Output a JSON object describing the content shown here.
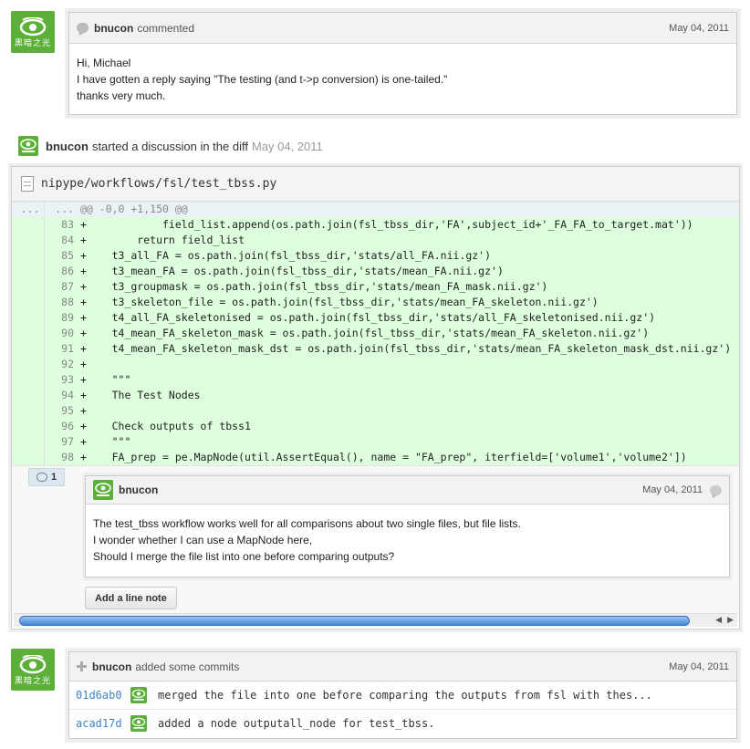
{
  "brand_color": "#5cb039",
  "avatar_text": "黑暗之光",
  "comment1": {
    "author": "bnucon",
    "action": "commented",
    "date": "May 04, 2011",
    "lines": [
      "Hi, Michael",
      "I have gotten a reply saying \"The testing (and t->p conversion) is one-tailed.\"",
      "thanks very much."
    ]
  },
  "discussion": {
    "author": "bnucon",
    "action": "started a discussion in the diff",
    "date": "May 04, 2011"
  },
  "diff": {
    "file_path": "nipype/workflows/fsl/test_tbss.py",
    "hunk": {
      "old_ln": "...",
      "new_ln": "...",
      "text": "@@ -0,0 +1,150 @@"
    },
    "lines": [
      {
        "ln": "83",
        "text": "+            field_list.append(os.path.join(fsl_tbss_dir,'FA',subject_id+'_FA_FA_to_target.mat'))"
      },
      {
        "ln": "84",
        "text": "+        return field_list"
      },
      {
        "ln": "85",
        "text": "+    t3_all_FA = os.path.join(fsl_tbss_dir,'stats/all_FA.nii.gz')"
      },
      {
        "ln": "86",
        "text": "+    t3_mean_FA = os.path.join(fsl_tbss_dir,'stats/mean_FA.nii.gz')"
      },
      {
        "ln": "87",
        "text": "+    t3_groupmask = os.path.join(fsl_tbss_dir,'stats/mean_FA_mask.nii.gz')"
      },
      {
        "ln": "88",
        "text": "+    t3_skeleton_file = os.path.join(fsl_tbss_dir,'stats/mean_FA_skeleton.nii.gz')"
      },
      {
        "ln": "89",
        "text": "+    t4_all_FA_skeletonised = os.path.join(fsl_tbss_dir,'stats/all_FA_skeletonised.nii.gz')"
      },
      {
        "ln": "90",
        "text": "+    t4_mean_FA_skeleton_mask = os.path.join(fsl_tbss_dir,'stats/mean_FA_skeleton.nii.gz')"
      },
      {
        "ln": "91",
        "text": "+    t4_mean_FA_skeleton_mask_dst = os.path.join(fsl_tbss_dir,'stats/mean_FA_skeleton_mask_dst.nii.gz')"
      },
      {
        "ln": "92",
        "text": "+"
      },
      {
        "ln": "93",
        "text": "+    \"\"\""
      },
      {
        "ln": "94",
        "text": "+    The Test Nodes"
      },
      {
        "ln": "95",
        "text": "+"
      },
      {
        "ln": "96",
        "text": "+    Check outputs of tbss1"
      },
      {
        "ln": "97",
        "text": "+    \"\"\""
      },
      {
        "ln": "98",
        "text": "+    FA_prep = pe.MapNode(util.AssertEqual(), name = \"FA_prep\", iterfield=['volume1','volume2'])"
      }
    ],
    "note_count": "1",
    "inline_comment": {
      "author": "bnucon",
      "date": "May 04, 2011",
      "lines": [
        "The test_tbss workflow works well for all comparisons about two single files, but file lists.",
        "I wonder whether I can use a MapNode here,",
        "Should I merge the file list into one before comparing outputs?"
      ]
    },
    "add_note_label": "Add a line note"
  },
  "commits": {
    "author": "bnucon",
    "action": "added some commits",
    "date": "May 04, 2011",
    "items": [
      {
        "sha": "01d6ab0",
        "message": "merged the file into one before comparing the outputs from fsl with thes..."
      },
      {
        "sha": "acad17d",
        "message": "added a node outputall_node for test_tbss."
      }
    ]
  }
}
